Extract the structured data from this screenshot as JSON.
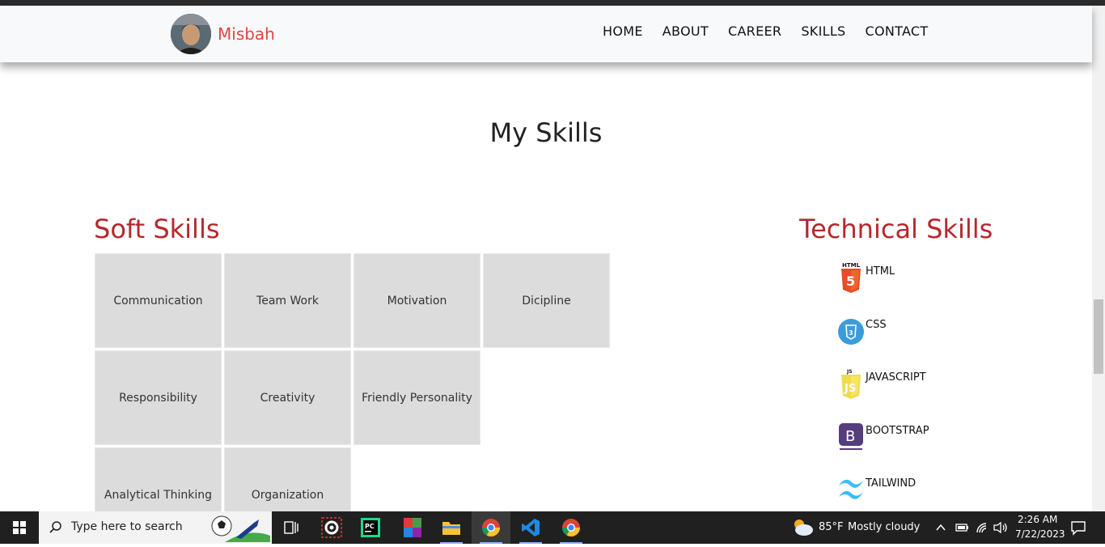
{
  "navbar": {
    "brand": "Misbah",
    "links": [
      "HOME",
      "ABOUT",
      "CAREER",
      "SKILLS",
      "CONTACT"
    ]
  },
  "main": {
    "title": "My Skills",
    "soft_heading": "Soft Skills",
    "tech_heading": "Technical Skills",
    "soft_skills": [
      "Communication",
      "Team Work",
      "Motivation",
      "Dicipline",
      "Responsibility",
      "Creativity",
      "Friendly Personality",
      "Analytical Thinking",
      "Organization"
    ],
    "tech_skills": [
      {
        "label": "HTML",
        "icon": "html5-icon"
      },
      {
        "label": "CSS",
        "icon": "css3-icon"
      },
      {
        "label": "JAVASCRIPT",
        "icon": "javascript-icon"
      },
      {
        "label": "BOOTSTRAP",
        "icon": "bootstrap-icon"
      },
      {
        "label": "TAILWIND",
        "icon": "tailwind-icon"
      }
    ]
  },
  "taskbar": {
    "search_placeholder": "Type here to search",
    "weather_temp": "85°F",
    "weather_desc": "Mostly cloudy",
    "time": "2:26 AM",
    "date": "7/22/2023"
  },
  "colors": {
    "accent": "#b5282d",
    "brand": "#e0463e",
    "tile_bg": "#dcdcdc",
    "navbar_bg": "#f8f9fa",
    "taskbar_bg": "#202020"
  }
}
